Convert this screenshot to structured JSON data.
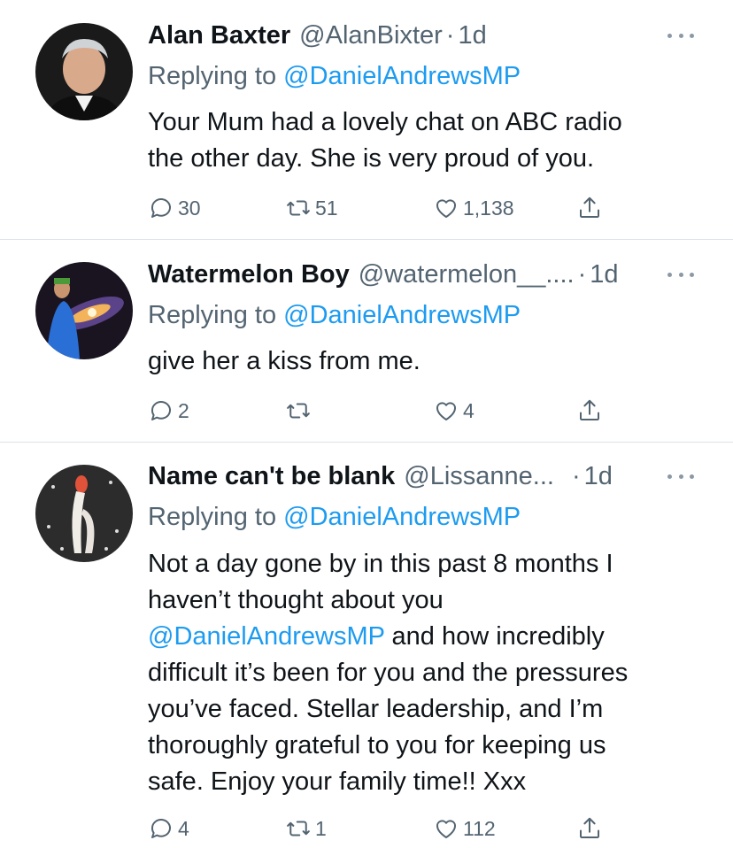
{
  "tweets": [
    {
      "name": "Alan Baxter",
      "handle": "@AlanBixter",
      "time": "1d",
      "replying_label": "Replying to",
      "replying_handle": "@DanielAndrewsMP",
      "text_lines": [
        "Your Mum had a lovely chat on ABC radio",
        "the other day. She is very proud of you."
      ],
      "replies": "30",
      "retweets": "51",
      "likes": "1,138"
    },
    {
      "name": "Watermelon Boy",
      "handle": "@watermelon__....",
      "time": "1d",
      "replying_label": "Replying to",
      "replying_handle": "@DanielAndrewsMP",
      "text_lines": [
        "give her a kiss from me."
      ],
      "replies": "2",
      "retweets": "",
      "likes": "4"
    },
    {
      "name": "Name can't be blank",
      "handle": "@Lissanne...",
      "time": "1d",
      "replying_label": "Replying to",
      "replying_handle": "@DanielAndrewsMP",
      "text_lines": [
        "Not a day gone by in this past 8 months I",
        "haven’t thought about you",
        "and how incredibly",
        "difficult it’s been for you and the pressures",
        "you’ve faced. Stellar leadership, and I’m",
        "thoroughly grateful to you for keeping us",
        "safe. Enjoy your family time!! Xxx"
      ],
      "text_mention": "@DanielAndrewsMP",
      "replies": "4",
      "retweets": "1",
      "likes": "112"
    }
  ],
  "icons": {
    "reply": "reply-icon",
    "retweet": "retweet-icon",
    "like": "heart-icon",
    "share": "share-icon",
    "more": "more-icon"
  },
  "colors": {
    "link": "#1d9bf0",
    "secondary": "#536471",
    "text": "#0f1419",
    "divider": "#dde3e8"
  }
}
